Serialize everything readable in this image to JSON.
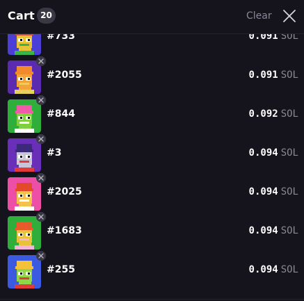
{
  "header": {
    "title": "Cart",
    "count": "20",
    "clear_label": "Clear",
    "close_icon": "close-icon"
  },
  "items": [
    {
      "name": "#733",
      "price": "0.091",
      "unit": "SOL",
      "colors": {
        "bg": "#4b3fd8",
        "face": "#e8c33a",
        "hat": "#d9482b",
        "accent": "#3bb34a"
      }
    },
    {
      "name": "#2055",
      "price": "0.091",
      "unit": "SOL",
      "colors": {
        "bg": "#5a2ab0",
        "face": "#f2a33a",
        "hat": "#f08a2c",
        "accent": "#e4d25a"
      }
    },
    {
      "name": "#844",
      "price": "0.092",
      "unit": "SOL",
      "colors": {
        "bg": "#2fae3c",
        "face": "#7fd03e",
        "hat": "#f05aa8",
        "accent": "#ffffff"
      }
    },
    {
      "name": "#3",
      "price": "0.094",
      "unit": "SOL",
      "colors": {
        "bg": "#6a2fb8",
        "face": "#c9c4d6",
        "hat": "#3b2a7a",
        "accent": "#e23a3a"
      }
    },
    {
      "name": "#2025",
      "price": "0.094",
      "unit": "SOL",
      "colors": {
        "bg": "#ee4fa6",
        "face": "#f2c24a",
        "hat": "#e24a2a",
        "accent": "#ffffff"
      }
    },
    {
      "name": "#1683",
      "price": "0.094",
      "unit": "SOL",
      "colors": {
        "bg": "#2fae3c",
        "face": "#e8c33a",
        "hat": "#e85a2a",
        "accent": "#f2b4d8"
      }
    },
    {
      "name": "#255",
      "price": "0.094",
      "unit": "SOL",
      "colors": {
        "bg": "#3b5ae0",
        "face": "#8fd64a",
        "hat": "#f2c23a",
        "accent": "#e23a3a"
      }
    }
  ]
}
